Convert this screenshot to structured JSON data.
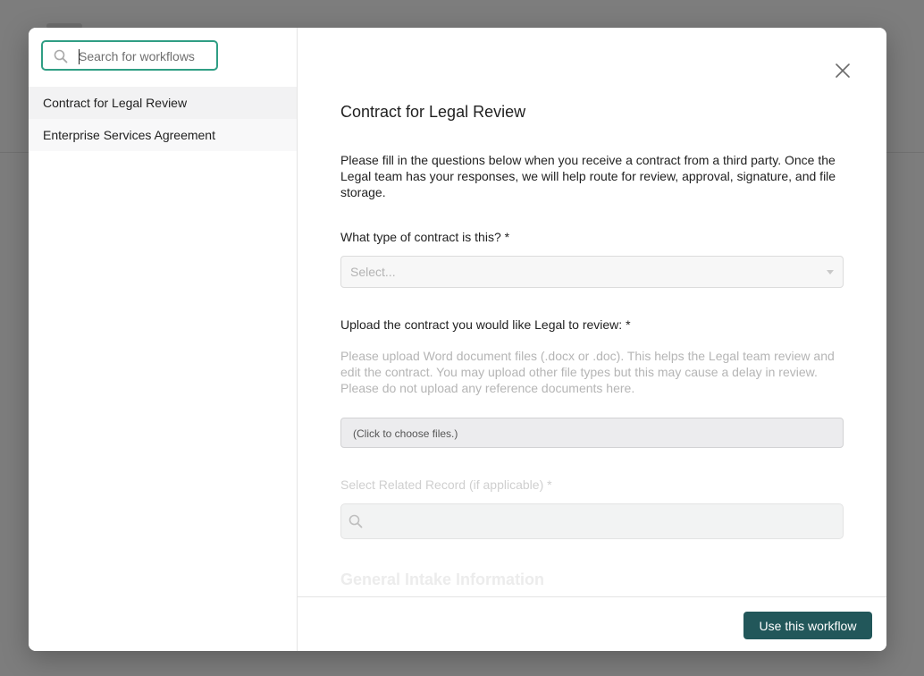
{
  "sidebar": {
    "search": {
      "placeholder": "Search for workflows",
      "value": ""
    },
    "items": [
      {
        "label": "Contract for Legal Review",
        "selected": true
      },
      {
        "label": "Enterprise Services Agreement",
        "selected": false
      }
    ]
  },
  "form": {
    "title": "Contract for Legal Review",
    "description": "Please fill in the questions below when you receive a contract from a third party. Once the Legal team has your responses, we will help route for review, approval, signature, and file storage.",
    "q_contract_type": {
      "label": "What type of contract is this? *",
      "placeholder": "Select..."
    },
    "q_upload": {
      "label": "Upload the contract you would like Legal to review: *",
      "help": "Please upload Word document files (.docx or .doc). This helps the Legal team review and edit the contract. You may upload other file types but this may cause a delay in review. Please do not upload any reference documents here.",
      "button_label": "(Click to choose files.)"
    },
    "q_related": {
      "label": "Select Related Record (if applicable) *"
    },
    "next_section_heading": "General Intake Information"
  },
  "footer": {
    "primary_label": "Use this workflow"
  },
  "icons": {
    "search": "search-icon",
    "close": "close-icon",
    "dropdown": "chevron-down-icon"
  },
  "colors": {
    "accent_focus": "#2f9e84",
    "primary_button": "#22575a",
    "overlay": "#7d7d7d"
  }
}
